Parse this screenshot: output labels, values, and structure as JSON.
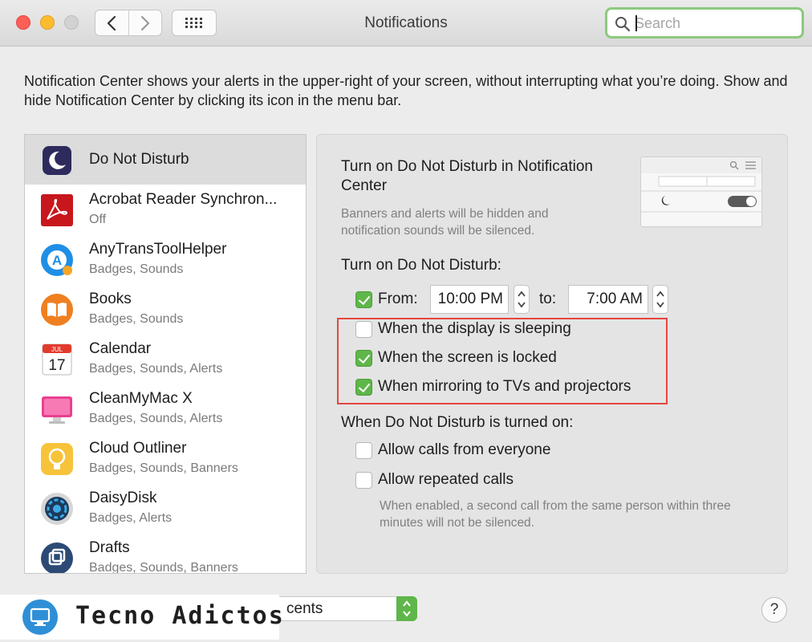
{
  "window": {
    "title": "Notifications",
    "search_placeholder": "Search"
  },
  "intro_text": "Notification Center shows your alerts in the upper-right of your screen, without interrupting what you’re doing. Show and hide Notification Center by clicking its icon in the menu bar.",
  "apps": [
    {
      "name": "Do Not Disturb",
      "subtitle": "",
      "icon": "moon-icon",
      "selected": true
    },
    {
      "name": "Acrobat Reader Synchron...",
      "subtitle": "Off",
      "icon": "acrobat-icon"
    },
    {
      "name": "AnyTransToolHelper",
      "subtitle": "Badges, Sounds",
      "icon": "anytrans-icon"
    },
    {
      "name": "Books",
      "subtitle": "Badges, Sounds",
      "icon": "books-icon"
    },
    {
      "name": "Calendar",
      "subtitle": "Badges, Sounds, Alerts",
      "icon": "calendar-icon",
      "calendar_month": "JUL",
      "calendar_day": "17"
    },
    {
      "name": "CleanMyMac X",
      "subtitle": "Badges, Sounds, Alerts",
      "icon": "cleanmymac-icon"
    },
    {
      "name": "Cloud Outliner",
      "subtitle": "Badges, Sounds, Banners",
      "icon": "cloud-outliner-icon"
    },
    {
      "name": "DaisyDisk",
      "subtitle": "Badges, Alerts",
      "icon": "daisydisk-icon"
    },
    {
      "name": "Drafts",
      "subtitle": "Badges, Sounds, Banners",
      "icon": "drafts-icon"
    }
  ],
  "dnd": {
    "heading": "Turn on Do Not Disturb in Notification Center",
    "help_text": "Banners and alerts will be hidden and notification sounds will be silenced.",
    "schedule_label": "Turn on Do Not Disturb:",
    "from_label": "From:",
    "from_checked": true,
    "from_time": "10:00 PM",
    "to_label": "to:",
    "to_time": "7:00 AM",
    "options": [
      {
        "label": "When the display is sleeping",
        "checked": false
      },
      {
        "label": "When the screen is locked",
        "checked": true
      },
      {
        "label": "When mirroring to TVs and projectors",
        "checked": true
      }
    ],
    "when_on_label": "When Do Not Disturb is turned on:",
    "call_options": [
      {
        "label": "Allow calls from everyone",
        "checked": false
      },
      {
        "label": "Allow repeated calls",
        "checked": false
      }
    ],
    "repeat_note": "When enabled, a second call from the same person within three minutes will not be silenced."
  },
  "bottom": {
    "sort_value": "cents",
    "help_label": "?"
  },
  "watermark": {
    "text": "Tecno Adictos"
  },
  "colors": {
    "accent_green": "#5fb64a",
    "highlight_red": "#e5463f",
    "search_focus": "#8cc97e"
  }
}
